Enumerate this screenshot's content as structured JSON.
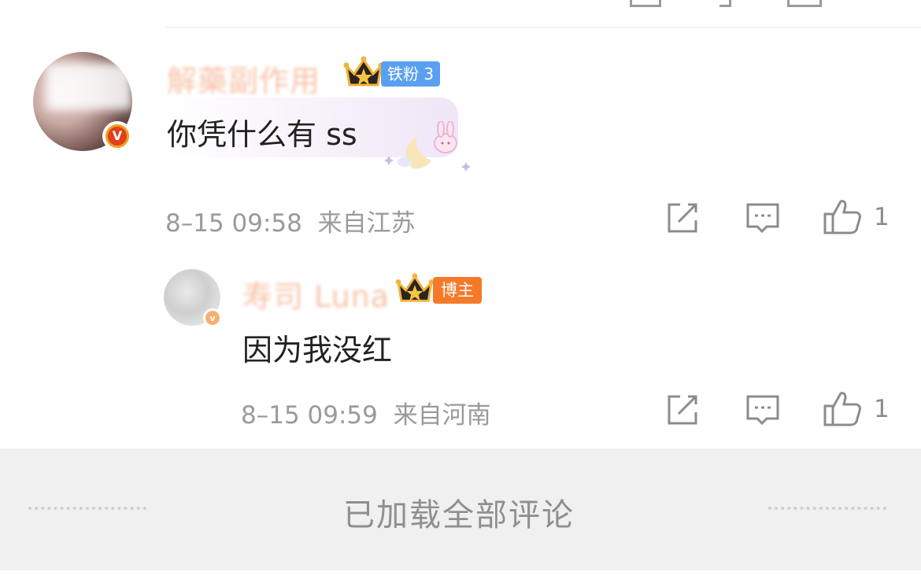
{
  "colors": {
    "accent_orange": "#f47a2a",
    "fan_badge_blue": "#5aa0f0",
    "meta_gray": "#9a9a9a"
  },
  "comment": {
    "username": "解藥副作用",
    "fan_badge": "铁粉 3",
    "text": "你凭什么有 ss",
    "time": "8–15 09:58",
    "location": "来自江苏",
    "like_count": "1",
    "icons": [
      "share-icon",
      "comment-icon",
      "thumbs-up-icon"
    ]
  },
  "reply": {
    "username": "寿司 Luna",
    "role_badge": "博主",
    "text": "因为我没红",
    "time": "8–15 09:59",
    "location": "来自河南",
    "like_count": "1",
    "icons": [
      "share-icon",
      "comment-icon",
      "thumbs-up-icon"
    ]
  },
  "footer": {
    "text": "已加载全部评论"
  }
}
